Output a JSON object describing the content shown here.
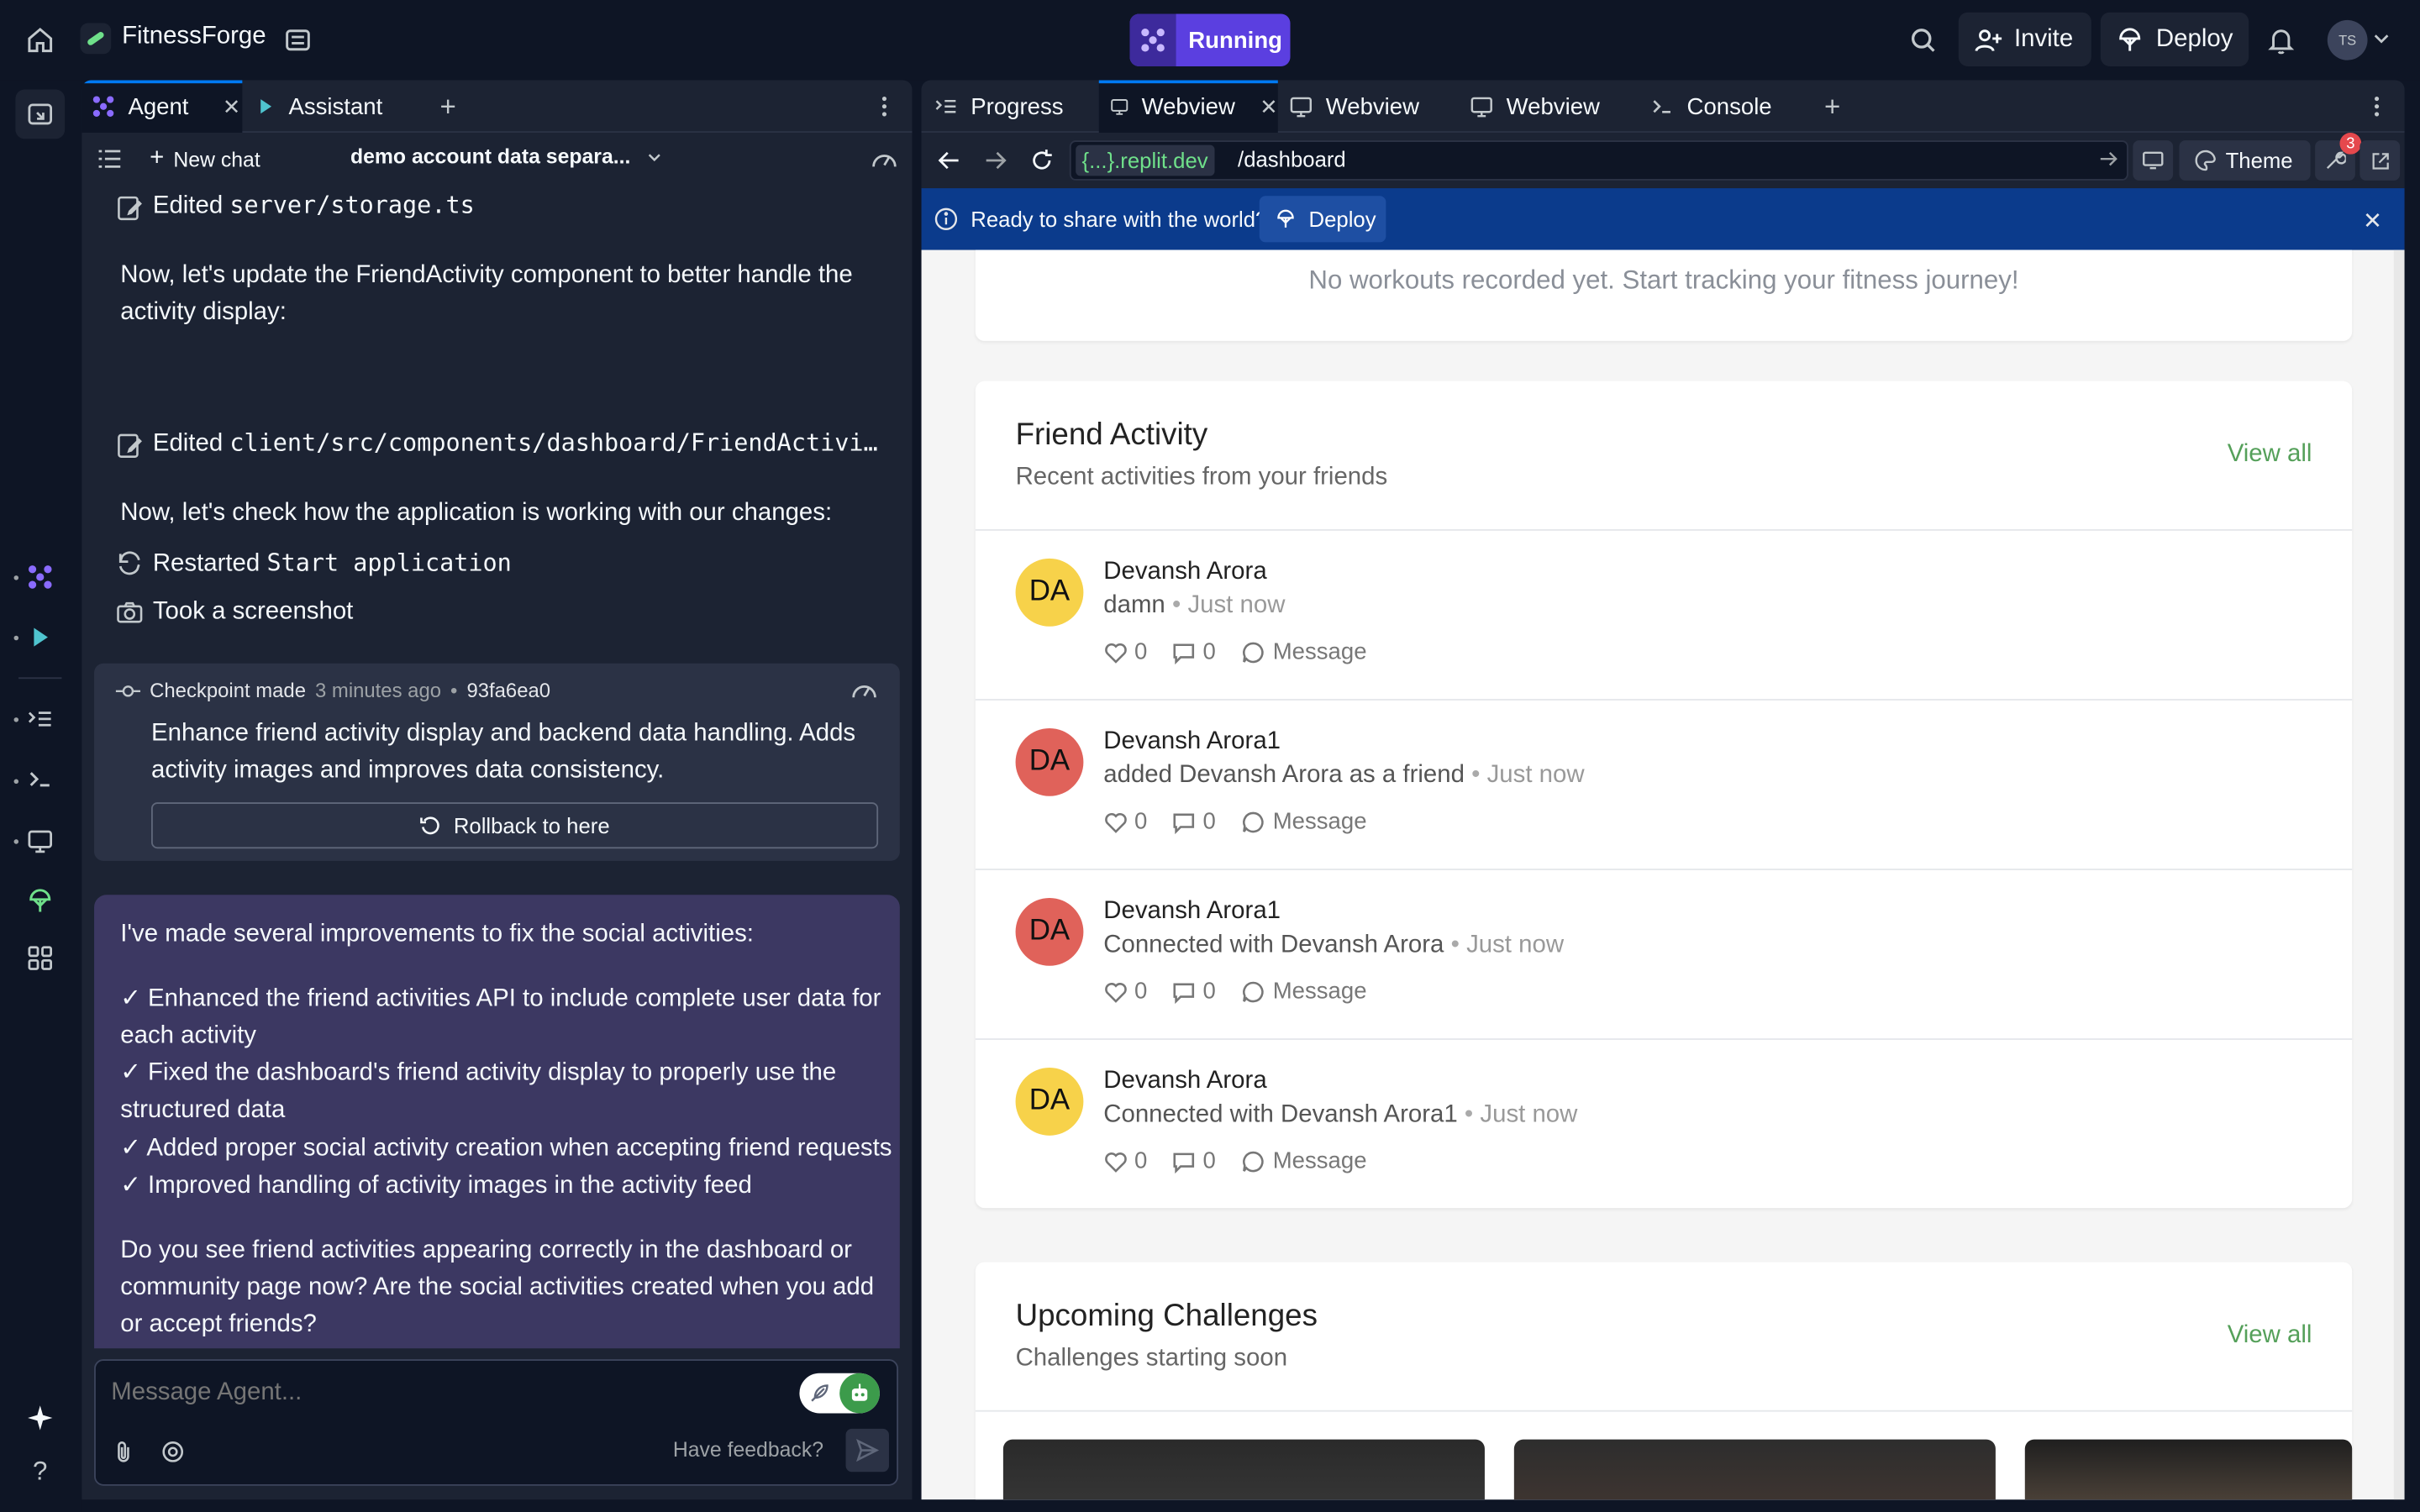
{
  "topbar": {
    "project_name": "FitnessForge",
    "run_label": "Running",
    "invite_label": "Invite",
    "deploy_label": "Deploy",
    "avatar_initials": "TS"
  },
  "left_tabs": [
    {
      "label": "Agent"
    },
    {
      "label": "Assistant"
    }
  ],
  "agent_header": {
    "new_chat_label": "New chat",
    "chat_title": "demo account data separa..."
  },
  "chat": {
    "edited_1_prefix": "Edited",
    "edited_1_file": "server/storage.ts",
    "msg_1": "Now, let's update the FriendActivity component to better handle the activity display:",
    "edited_2_prefix": "Edited",
    "edited_2_file": "client/src/components/dashboard/FriendActivi…",
    "msg_2": "Now, let's check how the application is working with our changes:",
    "restarted_prefix": "Restarted",
    "restarted_name": "Start application",
    "screenshot_label": "Took a screenshot",
    "checkpoint": {
      "label": "Checkpoint made",
      "time": "3 minutes ago",
      "hash": "93fa6ea0",
      "description": "Enhance friend activity display and backend data handling. Adds activity images and improves data consistency.",
      "rollback_label": "Rollback to here"
    },
    "agent_message": {
      "intro": "I've made several improvements to fix the social activities:",
      "bullets": [
        "✓ Enhanced the friend activities API to include complete user data for each activity",
        "✓ Fixed the dashboard's friend activity display to properly use the structured data",
        "✓ Added proper social activity creation when accepting friend requests",
        "✓ Improved handling of activity images in the activity feed"
      ],
      "question": "Do you see friend activities appearing correctly in the dashboard or community page now? Are the social activities created when you add or accept friends?"
    }
  },
  "composer": {
    "placeholder": "Message Agent...",
    "feedback_label": "Have feedback?"
  },
  "right_tabs": [
    {
      "label": "Progress"
    },
    {
      "label": "Webview"
    },
    {
      "label": "Webview"
    },
    {
      "label": "Webview"
    },
    {
      "label": "Console"
    }
  ],
  "address_bar": {
    "domain": "{...}.replit.dev",
    "path": "/dashboard",
    "theme_label": "Theme",
    "badge_count": "3"
  },
  "banner": {
    "text": "Ready to share with the world?",
    "deploy_label": "Deploy"
  },
  "webview": {
    "empty_workouts": "No workouts recorded yet. Start tracking your fitness journey!",
    "friend_activity": {
      "title": "Friend Activity",
      "subtitle": "Recent activities from your friends",
      "view_all": "View all",
      "items": [
        {
          "initials": "DA",
          "name": "Devansh Arora",
          "action": "damn",
          "time": "Just now",
          "likes": "0",
          "comments": "0",
          "message": "Message",
          "color": "#f7d24a"
        },
        {
          "initials": "DA",
          "name": "Devansh Arora1",
          "action": "added Devansh Arora as a friend",
          "time": "Just now",
          "likes": "0",
          "comments": "0",
          "message": "Message",
          "color": "#e0625a"
        },
        {
          "initials": "DA",
          "name": "Devansh Arora1",
          "action": "Connected with Devansh Arora",
          "time": "Just now",
          "likes": "0",
          "comments": "0",
          "message": "Message",
          "color": "#e0625a"
        },
        {
          "initials": "DA",
          "name": "Devansh Arora",
          "action": "Connected with Devansh Arora1",
          "time": "Just now",
          "likes": "0",
          "comments": "0",
          "message": "Message",
          "color": "#f7d24a"
        }
      ]
    },
    "challenges": {
      "title": "Upcoming Challenges",
      "subtitle": "Challenges starting soon",
      "view_all": "View all"
    }
  },
  "colors": {
    "app_bg": "#0e1525",
    "panel_bg": "#1c2333",
    "run_purple": "#5b3fe0",
    "agent_msg_bg": "#3c3862",
    "banner_blue": "#0b3b8c",
    "link_green": "#55a05a"
  }
}
